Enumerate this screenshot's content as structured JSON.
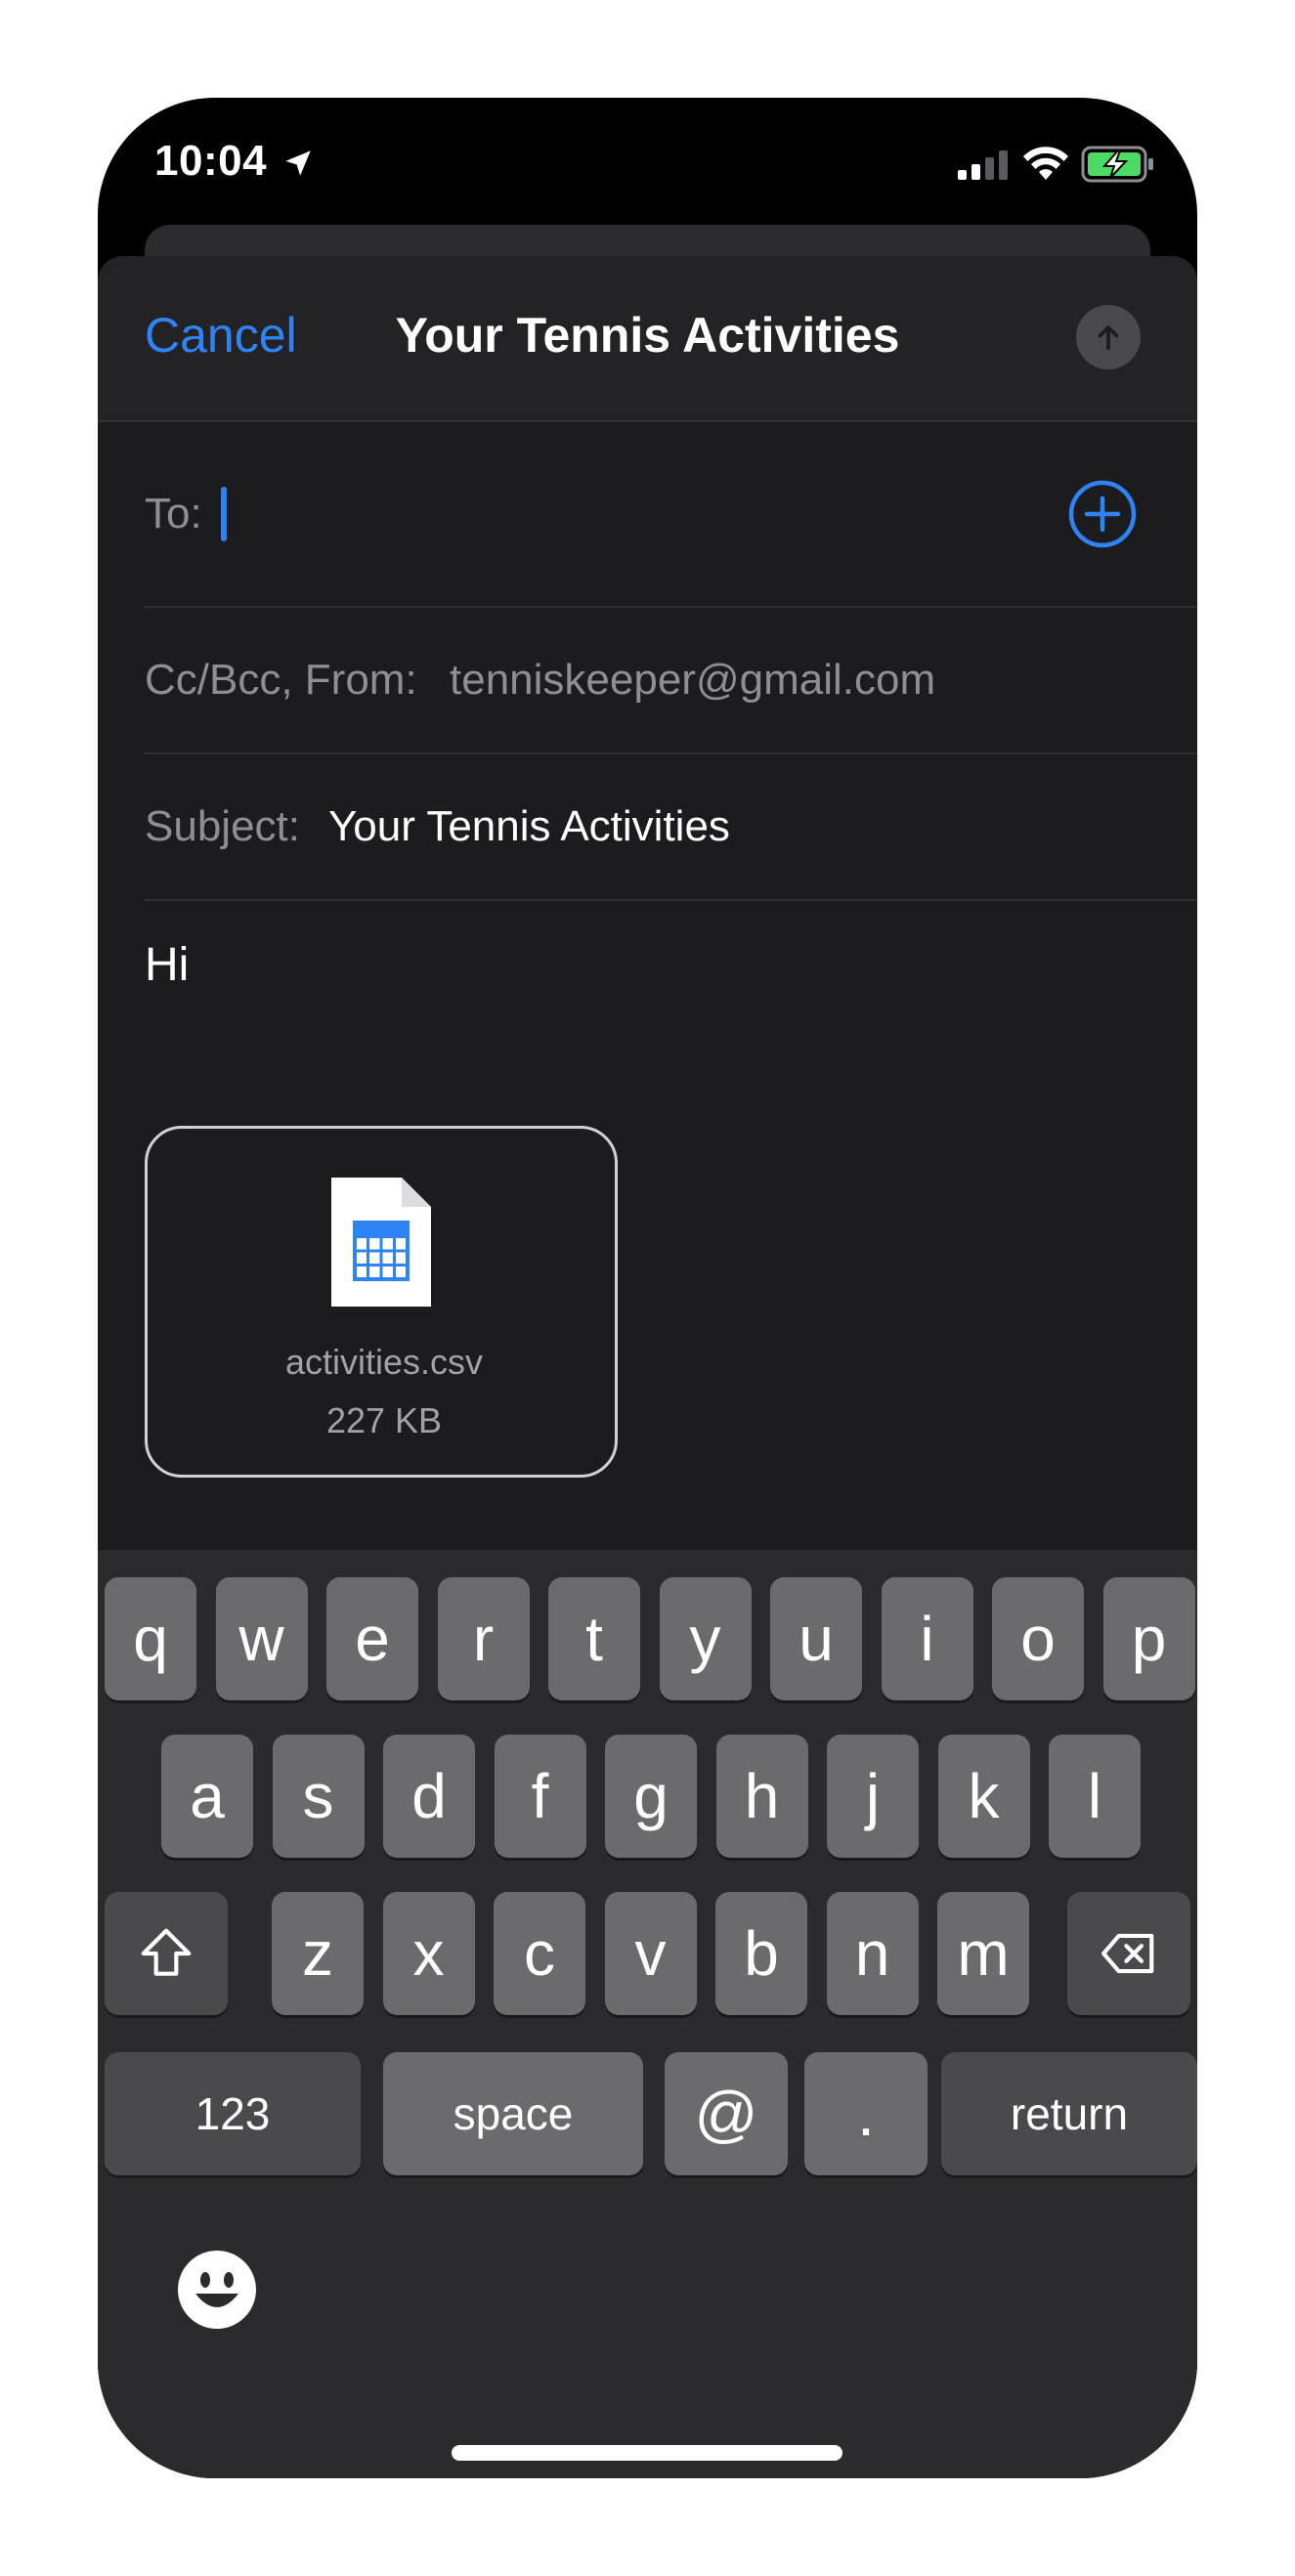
{
  "status_bar": {
    "time": "10:04",
    "location_icon": "location-arrow-icon",
    "signal_icon": "cellular-signal-icon",
    "wifi_icon": "wifi-icon",
    "battery_icon": "battery-charging-icon",
    "battery_color": "#4cd964"
  },
  "nav": {
    "cancel_label": "Cancel",
    "title": "Your Tennis Activities",
    "send_icon": "arrow-up-icon"
  },
  "fields": {
    "to_label": "To:",
    "add_icon": "plus-circle-icon",
    "cc_from_label": "Cc/Bcc, From:",
    "from_value": "tenniskeeper@gmail.com",
    "subject_label": "Subject:",
    "subject_value": "Your Tennis Activities"
  },
  "body": {
    "text": "Hi"
  },
  "attachment": {
    "file_name": "activities.csv",
    "file_size": "227 KB",
    "icon": "spreadsheet-file-icon"
  },
  "keyboard": {
    "row1": [
      "q",
      "w",
      "e",
      "r",
      "t",
      "y",
      "u",
      "i",
      "o",
      "p"
    ],
    "row2": [
      "a",
      "s",
      "d",
      "f",
      "g",
      "h",
      "j",
      "k",
      "l"
    ],
    "row3": [
      "z",
      "x",
      "c",
      "v",
      "b",
      "n",
      "m"
    ],
    "shift_icon": "shift-icon",
    "delete_icon": "delete-backspace-icon",
    "numbers_label": "123",
    "space_label": "space",
    "at_label": "@",
    "period_label": ".",
    "return_label": "return",
    "emoji_icon": "emoji-icon"
  },
  "colors": {
    "accent": "#2f84f5",
    "sheet_background": "#1c1c1e",
    "keyboard_background": "#2b2b2d",
    "key_background": "#6b6b6d"
  }
}
